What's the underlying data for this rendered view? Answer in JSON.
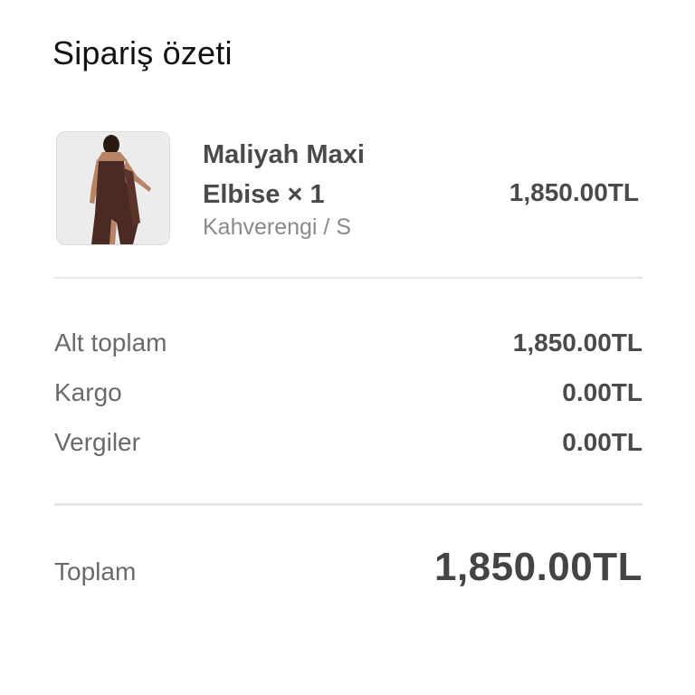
{
  "page": {
    "title": "Sipariş özeti"
  },
  "item": {
    "name": "Maliyah Maxi Elbise × 1",
    "variant": "Kahverengi / S",
    "price": "1,850.00TL",
    "image_icon": "product-dress-image",
    "dress_color": "#4a2a22"
  },
  "summary": {
    "subtotal_label": "Alt toplam",
    "subtotal_value": "1,850.00TL",
    "shipping_label": "Kargo",
    "shipping_value": "0.00TL",
    "taxes_label": "Vergiler",
    "taxes_value": "0.00TL"
  },
  "total": {
    "label": "Toplam",
    "value": "1,850.00TL"
  },
  "colors": {
    "text_primary": "#111111",
    "text_secondary": "#6a6a6a",
    "text_emphasis": "#4a4a4a",
    "divider": "#e6e6e6",
    "background": "#ffffff"
  }
}
